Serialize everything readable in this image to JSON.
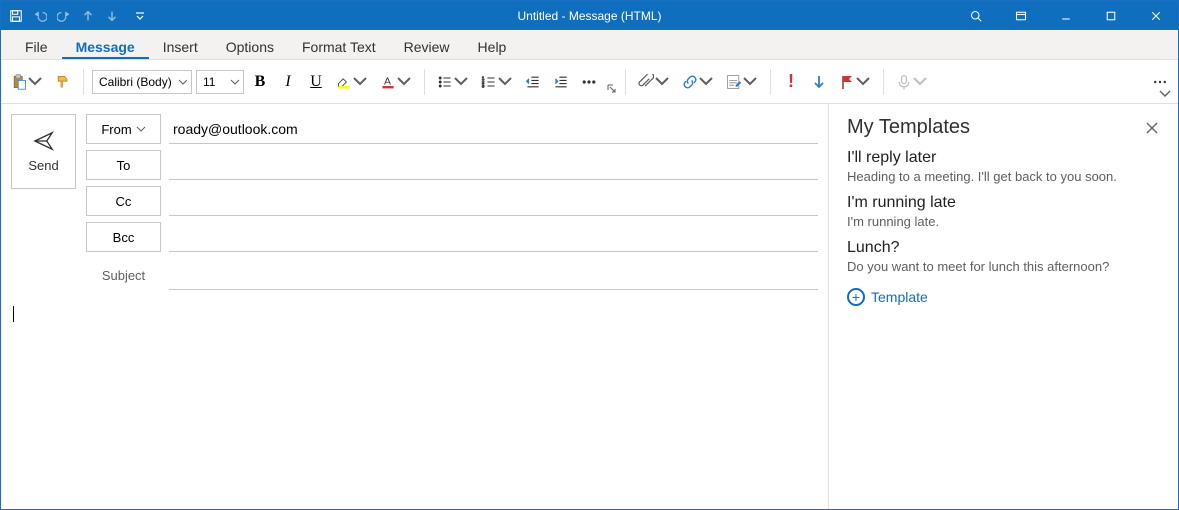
{
  "titlebar": {
    "title": "Untitled  -  Message (HTML)"
  },
  "menu": {
    "file": "File",
    "message": "Message",
    "insert": "Insert",
    "options": "Options",
    "format_text": "Format Text",
    "review": "Review",
    "help": "Help"
  },
  "ribbon": {
    "font_name": "Calibri (Body)",
    "font_size": "11"
  },
  "compose": {
    "send": "Send",
    "from_label": "From",
    "to_label": "To",
    "cc_label": "Cc",
    "bcc_label": "Bcc",
    "subject_label": "Subject",
    "from_value": "roady@outlook.com",
    "to_value": "",
    "cc_value": "",
    "bcc_value": "",
    "subject_value": ""
  },
  "pane": {
    "title": "My Templates",
    "add_label": "Template",
    "items": [
      {
        "title": "I'll reply later",
        "body": "Heading to a meeting. I'll get back to you soon."
      },
      {
        "title": "I'm running late",
        "body": "I'm running late."
      },
      {
        "title": "Lunch?",
        "body": "Do you want to meet for lunch this afternoon?"
      }
    ]
  }
}
